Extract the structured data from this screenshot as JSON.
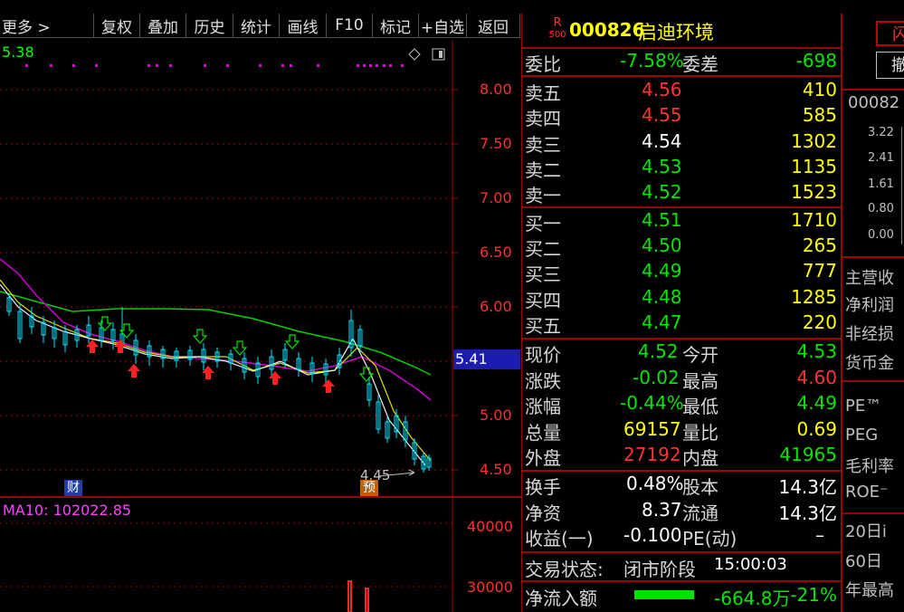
{
  "toolbar": {
    "items": [
      "更多 >",
      "复权",
      "叠加",
      "历史",
      "统计",
      "画线",
      "F10",
      "标记",
      "+自选",
      "返回"
    ]
  },
  "chart": {
    "ma_value": "5.38",
    "price_ticks": [
      "8.00",
      "7.50",
      "7.00",
      "6.50",
      "6.00",
      "5.00",
      "4.50"
    ],
    "current_price_tag": "5.41",
    "low_marker": "4.45",
    "fin_tag": "财",
    "pre_tag": "预",
    "vol_ma_label": "MA10: 102022.85",
    "vol_ticks": [
      "40000",
      "30000"
    ]
  },
  "quote": {
    "badge_top": "R",
    "badge_bottom": "500",
    "code": "000826",
    "name": "启迪环境",
    "weibi_label": "委比",
    "weibi_value": "-7.58%",
    "weicha_label": "委差",
    "weicha_value": "-698",
    "asks": [
      {
        "label": "卖五",
        "price": "4.56",
        "vol": "410"
      },
      {
        "label": "卖四",
        "price": "4.55",
        "vol": "585"
      },
      {
        "label": "卖三",
        "price": "4.54",
        "vol": "1302"
      },
      {
        "label": "卖二",
        "price": "4.53",
        "vol": "1135"
      },
      {
        "label": "卖一",
        "price": "4.52",
        "vol": "1523"
      }
    ],
    "bids": [
      {
        "label": "买一",
        "price": "4.51",
        "vol": "1710"
      },
      {
        "label": "买二",
        "price": "4.50",
        "vol": "265"
      },
      {
        "label": "买三",
        "price": "4.49",
        "vol": "777"
      },
      {
        "label": "买四",
        "price": "4.48",
        "vol": "1285"
      },
      {
        "label": "买五",
        "price": "4.47",
        "vol": "220"
      }
    ],
    "stats": [
      {
        "l1": "现价",
        "v1": "4.52",
        "l2": "今开",
        "v2": "4.53"
      },
      {
        "l1": "涨跌",
        "v1": "-0.02",
        "l2": "最高",
        "v2": "4.60"
      },
      {
        "l1": "涨幅",
        "v1": "-0.44%",
        "l2": "最低",
        "v2": "4.49"
      },
      {
        "l1": "总量",
        "v1": "69157",
        "l2": "量比",
        "v2": "0.69"
      },
      {
        "l1": "外盘",
        "v1": "27192",
        "l2": "内盘",
        "v2": "41965"
      }
    ],
    "fund": [
      {
        "l1": "换手",
        "v1": "0.48%",
        "l2": "股本",
        "v2": "14.3亿"
      },
      {
        "l1": "净资",
        "v1": "8.37",
        "l2": "流通",
        "v2": "14.3亿"
      },
      {
        "l1": "收益(一)",
        "v1": "-0.100",
        "l2": "PE(动)",
        "v2": "–"
      }
    ],
    "status_label": "交易状态:",
    "status_value": "闭市阶段",
    "status_time": "15:00:03",
    "flow_label": "净流入额",
    "flow_value": "-664.8万",
    "flow_pct": "-21%"
  },
  "side": {
    "btn1": "闪",
    "btn2": "撤",
    "code": "00082",
    "vals": [
      "3.22",
      "2.41",
      "1.61",
      "0.80",
      "0.00"
    ],
    "labels": [
      "主营收",
      "净利润",
      "非经损",
      "货币金",
      "PE™",
      "PEG",
      "毛利率",
      "ROE⁻",
      "20日i",
      "60日",
      "年最高"
    ]
  }
}
